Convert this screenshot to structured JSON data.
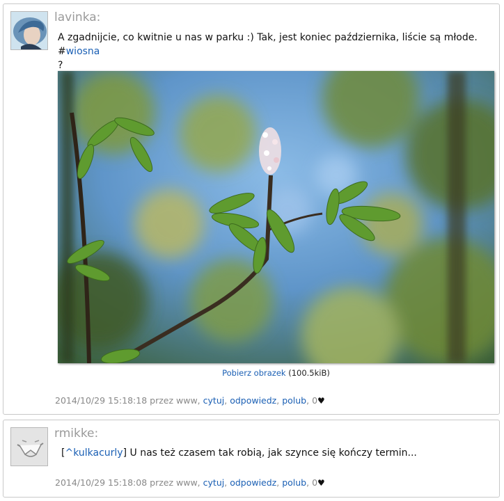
{
  "posts": [
    {
      "author": "lavinka:",
      "text_main": "A zgadnijcie, co kwitnie u nas w parku :) Tak, jest koniec października, liście są młode. #",
      "hashtag": "wiosna",
      "text_after": "?",
      "download_link": "Pobierz obrazek",
      "file_size": "(100.5kiB)",
      "meta": {
        "datetime": "2014/10/29 15:18:18",
        "via": "przez www,",
        "quote": "cytuj",
        "reply": "odpowiedz",
        "like": "polub",
        "likes_count": "0",
        "heart": "♥"
      }
    },
    {
      "author": "rmikke:",
      "reply_prefix": "[",
      "mention": "^kulkacurly",
      "reply_suffix": "]",
      "text": "U nas też czasem tak robią, jak szynce się kończy termin...",
      "meta": {
        "datetime": "2014/10/29 15:18:08",
        "via": "przez www,",
        "quote": "cytuj",
        "reply": "odpowiedz",
        "like": "polub",
        "likes_count": "0",
        "heart": "♥"
      }
    }
  ],
  "icons": [
    "lavinka-avatar",
    "rmikke-avatar",
    "heart-icon"
  ],
  "colors": {
    "link": "#1a5fb4",
    "meta": "#888888",
    "author": "#9a9a9a",
    "border": "#c8c8c8"
  }
}
